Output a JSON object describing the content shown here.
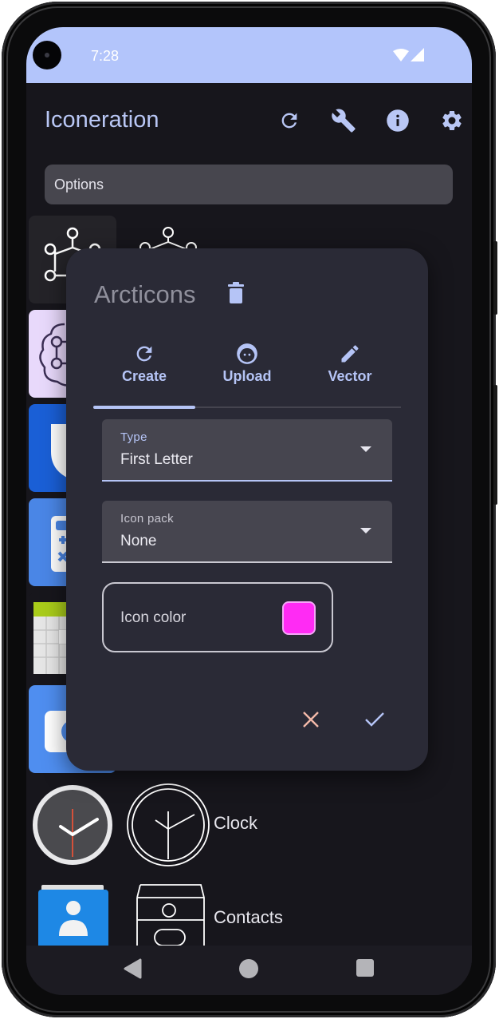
{
  "status_bar": {
    "time": "7:28",
    "icons": [
      "wifi-icon",
      "cellular-signal-icon"
    ]
  },
  "app_bar": {
    "title": "Iconeration",
    "actions": [
      {
        "name": "refresh",
        "icon": "refresh-icon"
      },
      {
        "name": "tools",
        "icon": "wrench-icon"
      },
      {
        "name": "info",
        "icon": "info-icon"
      },
      {
        "name": "settings",
        "icon": "gear-icon"
      }
    ]
  },
  "options_bar": {
    "label": "Options"
  },
  "app_list": [
    {
      "label": "Arcticons",
      "original_icon": "arcticons-network-icon",
      "generated_icon": "network-line-icon"
    },
    {
      "label": "",
      "original_icon": "brain-network-icon"
    },
    {
      "label": "",
      "original_icon": "shield-icon"
    },
    {
      "label": "",
      "original_icon": "calculator-icon"
    },
    {
      "label": "",
      "original_icon": "calendar-icon"
    },
    {
      "label": "",
      "original_icon": "camera-icon"
    },
    {
      "label": "Clock",
      "original_icon": "clock-icon",
      "generated_icon": "clock-line-icon"
    },
    {
      "label": "Contacts",
      "original_icon": "contacts-icon",
      "generated_icon": "contacts-line-icon"
    }
  ],
  "dialog": {
    "title": "Arcticons",
    "delete_icon": "trash-icon",
    "tabs": [
      {
        "label": "Create",
        "icon": "refresh-icon",
        "selected": true
      },
      {
        "label": "Upload",
        "icon": "face-icon",
        "selected": false
      },
      {
        "label": "Vector",
        "icon": "pencil-icon",
        "selected": false
      }
    ],
    "type_field": {
      "label": "Type",
      "value": "First Letter"
    },
    "icon_pack_field": {
      "label": "Icon pack",
      "value": "None"
    },
    "icon_color": {
      "label": "Icon color",
      "value": "#ff2bf4"
    },
    "cancel_icon": "close-icon",
    "confirm_icon": "check-icon"
  },
  "colors": {
    "accent": "#b5c4f6",
    "status_bar": "#b3c5fb",
    "dialog_bg": "#2a2a36",
    "cancel": "#f2b8a8"
  },
  "nav_bar": {
    "buttons": [
      "back",
      "home",
      "recents"
    ]
  }
}
